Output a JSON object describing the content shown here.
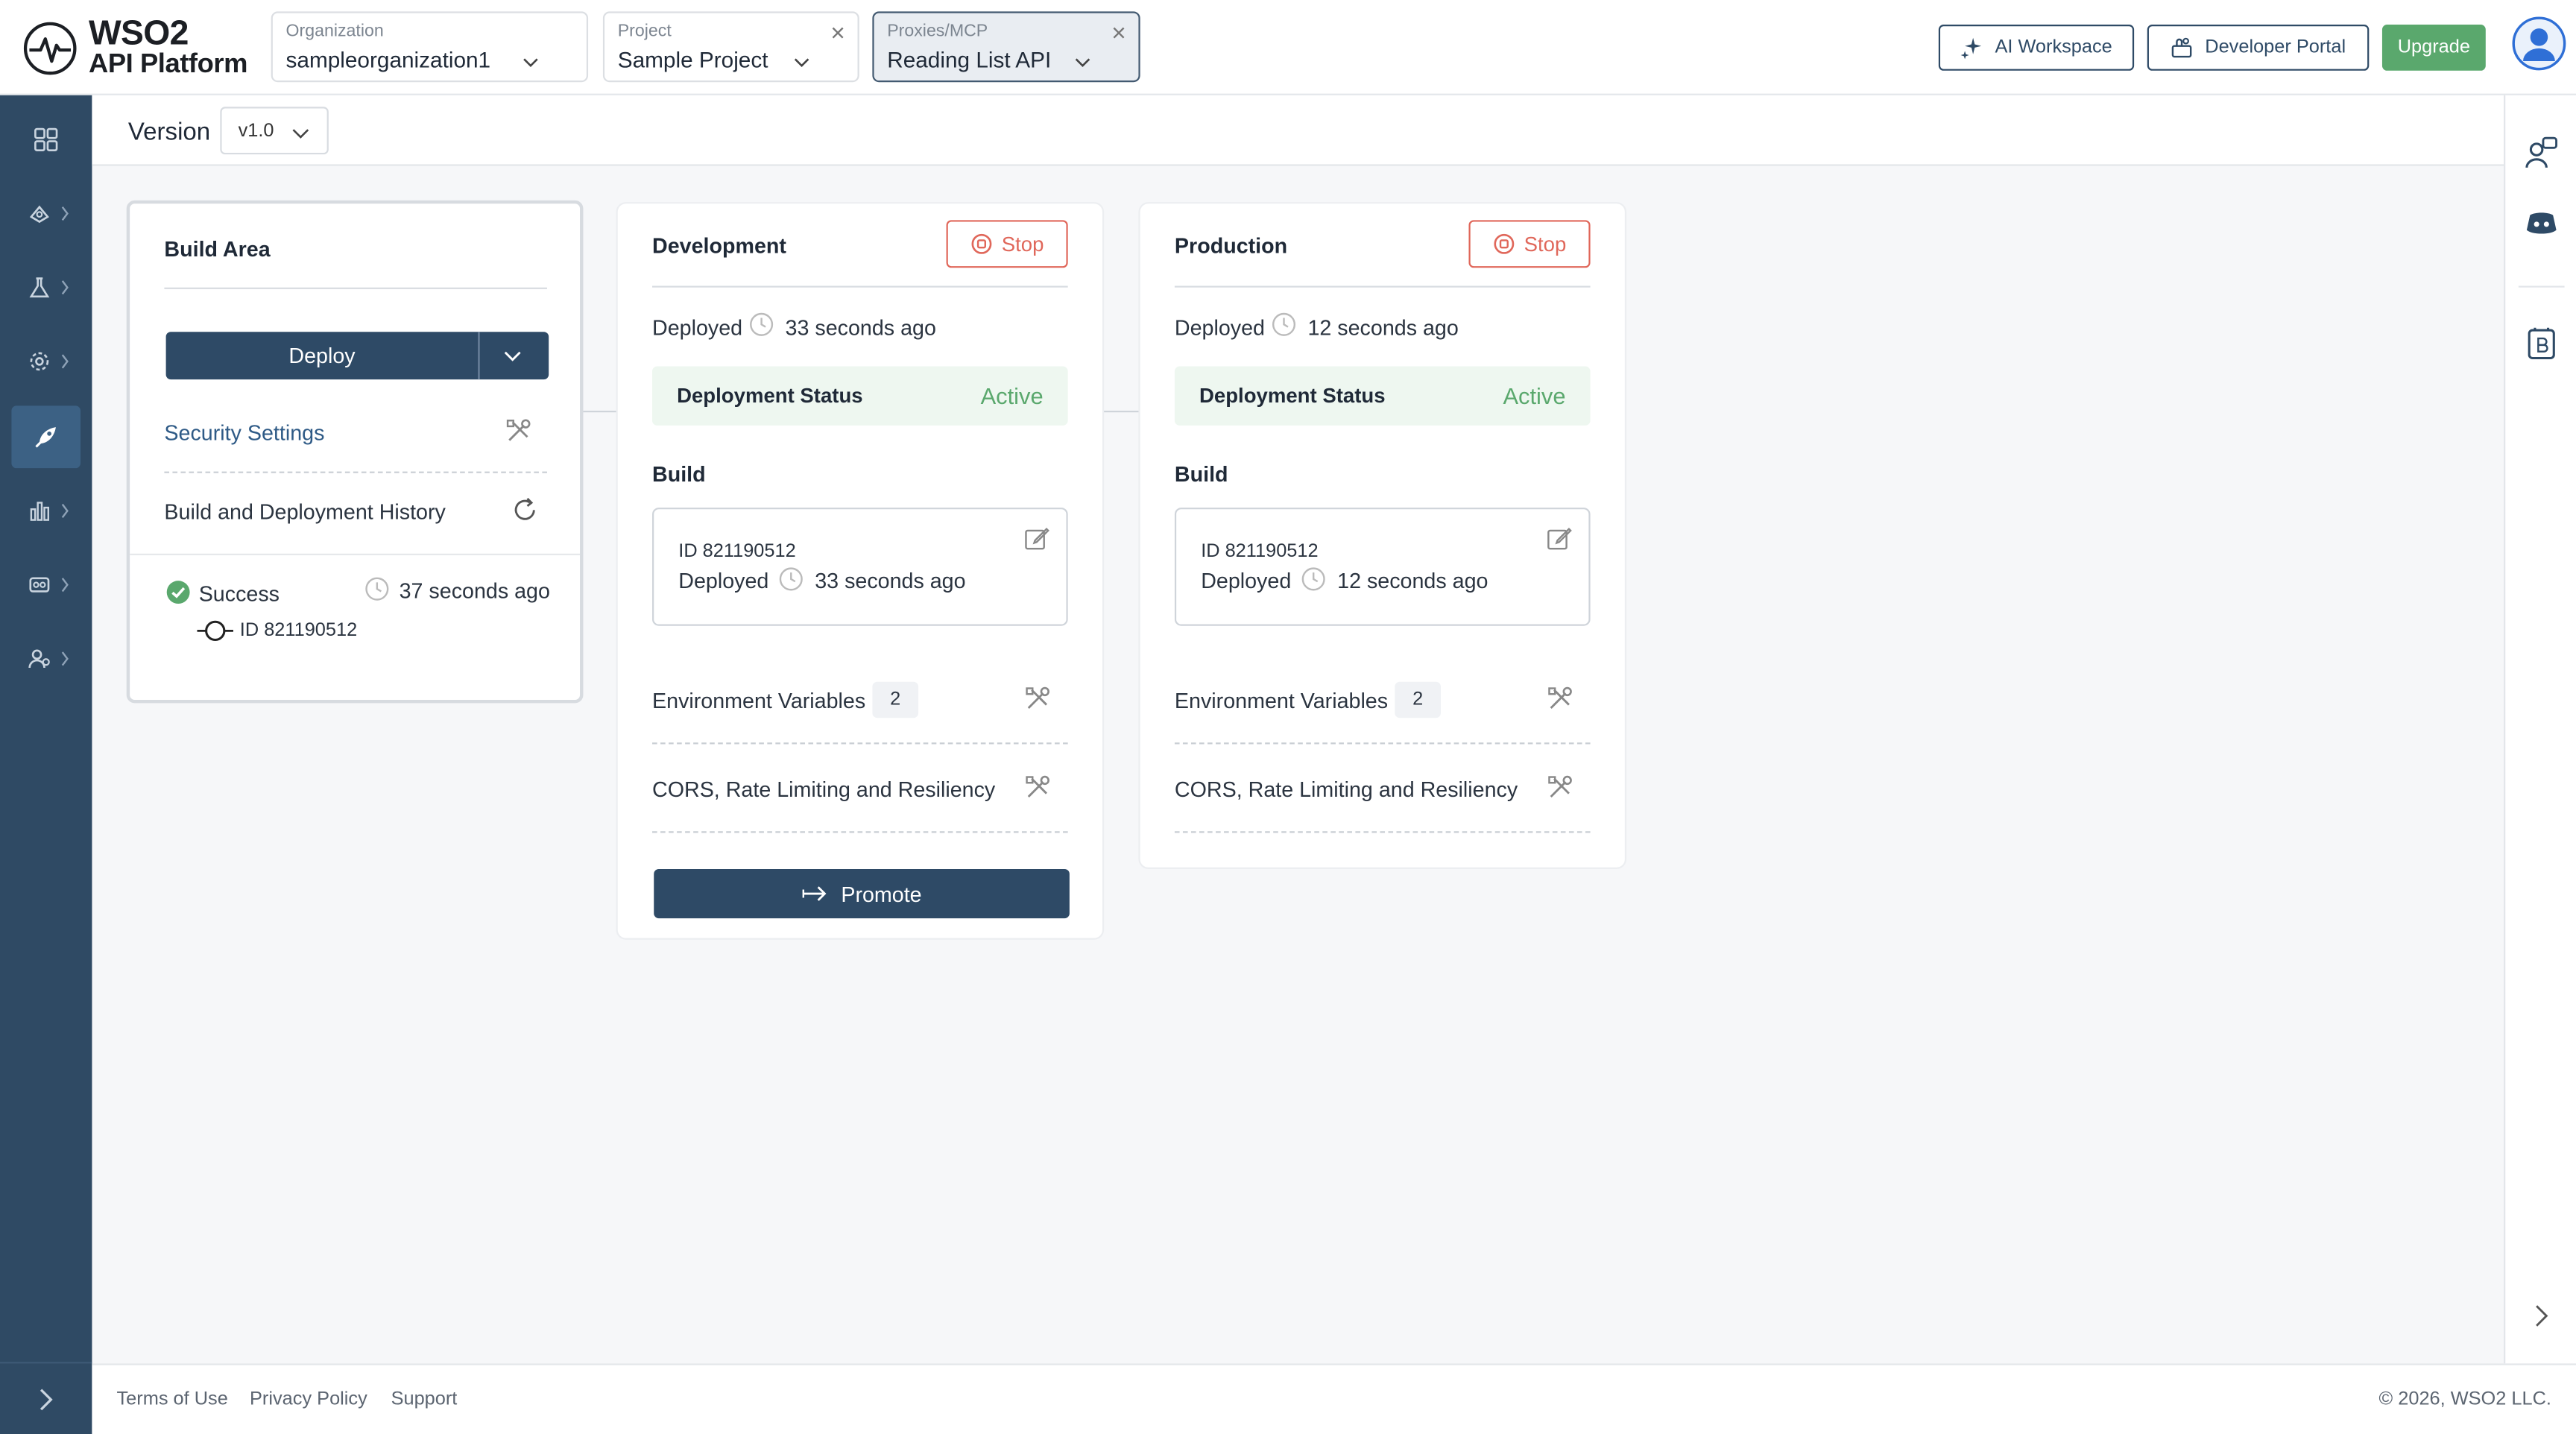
{
  "header": {
    "logo_line1": "WSO2",
    "logo_line2": "API Platform",
    "organization": {
      "label": "Organization",
      "value": "sampleorganization1"
    },
    "project": {
      "label": "Project",
      "value": "Sample Project"
    },
    "proxy": {
      "label": "Proxies/MCP",
      "value": "Reading List API"
    },
    "ai_workspace": "AI Workspace",
    "developer_portal": "Developer Portal",
    "upgrade": "Upgrade"
  },
  "sidebar": {
    "items": [
      {
        "icon": "overview-grid-icon"
      },
      {
        "icon": "develop-icon"
      },
      {
        "icon": "test-flask-icon"
      },
      {
        "icon": "settings-gear-icon"
      },
      {
        "icon": "deploy-rocket-icon",
        "selected": true
      },
      {
        "icon": "analytics-chart-icon"
      },
      {
        "icon": "manage-icon"
      },
      {
        "icon": "admin-users-icon"
      }
    ]
  },
  "version": {
    "label": "Version",
    "value": "v1.0"
  },
  "build_area": {
    "title": "Build Area",
    "deploy": "Deploy",
    "security_settings": "Security Settings",
    "history": "Build and Deployment History",
    "entry_status": "Success",
    "entry_time": "37 seconds ago",
    "entry_id": "ID 821190512"
  },
  "environments": [
    {
      "name": "Development",
      "stop": "Stop",
      "deployed_label": "Deployed",
      "deployed_time": "33 seconds ago",
      "status_label": "Deployment Status",
      "status_value": "Active",
      "build_title": "Build",
      "build_id": "ID 821190512",
      "build_deployed_label": "Deployed",
      "build_deployed_time": "33 seconds ago",
      "env_vars_label": "Environment Variables",
      "env_vars_count": "2",
      "cors_label": "CORS, Rate Limiting and Resiliency",
      "promote": "Promote"
    },
    {
      "name": "Production",
      "stop": "Stop",
      "deployed_label": "Deployed",
      "deployed_time": "12 seconds ago",
      "status_label": "Deployment Status",
      "status_value": "Active",
      "build_title": "Build",
      "build_id": "ID 821190512",
      "build_deployed_label": "Deployed",
      "build_deployed_time": "12 seconds ago",
      "env_vars_label": "Environment Variables",
      "env_vars_count": "2",
      "cors_label": "CORS, Rate Limiting and Resiliency"
    }
  ],
  "footer": {
    "terms": "Terms of Use",
    "privacy": "Privacy Policy",
    "support": "Support",
    "copyright": "© 2026, WSO2 LLC."
  },
  "colors": {
    "primary": "#2e4a66",
    "success": "#5aa86d",
    "danger": "#e0675a",
    "sidebar": "#2f4a64"
  }
}
